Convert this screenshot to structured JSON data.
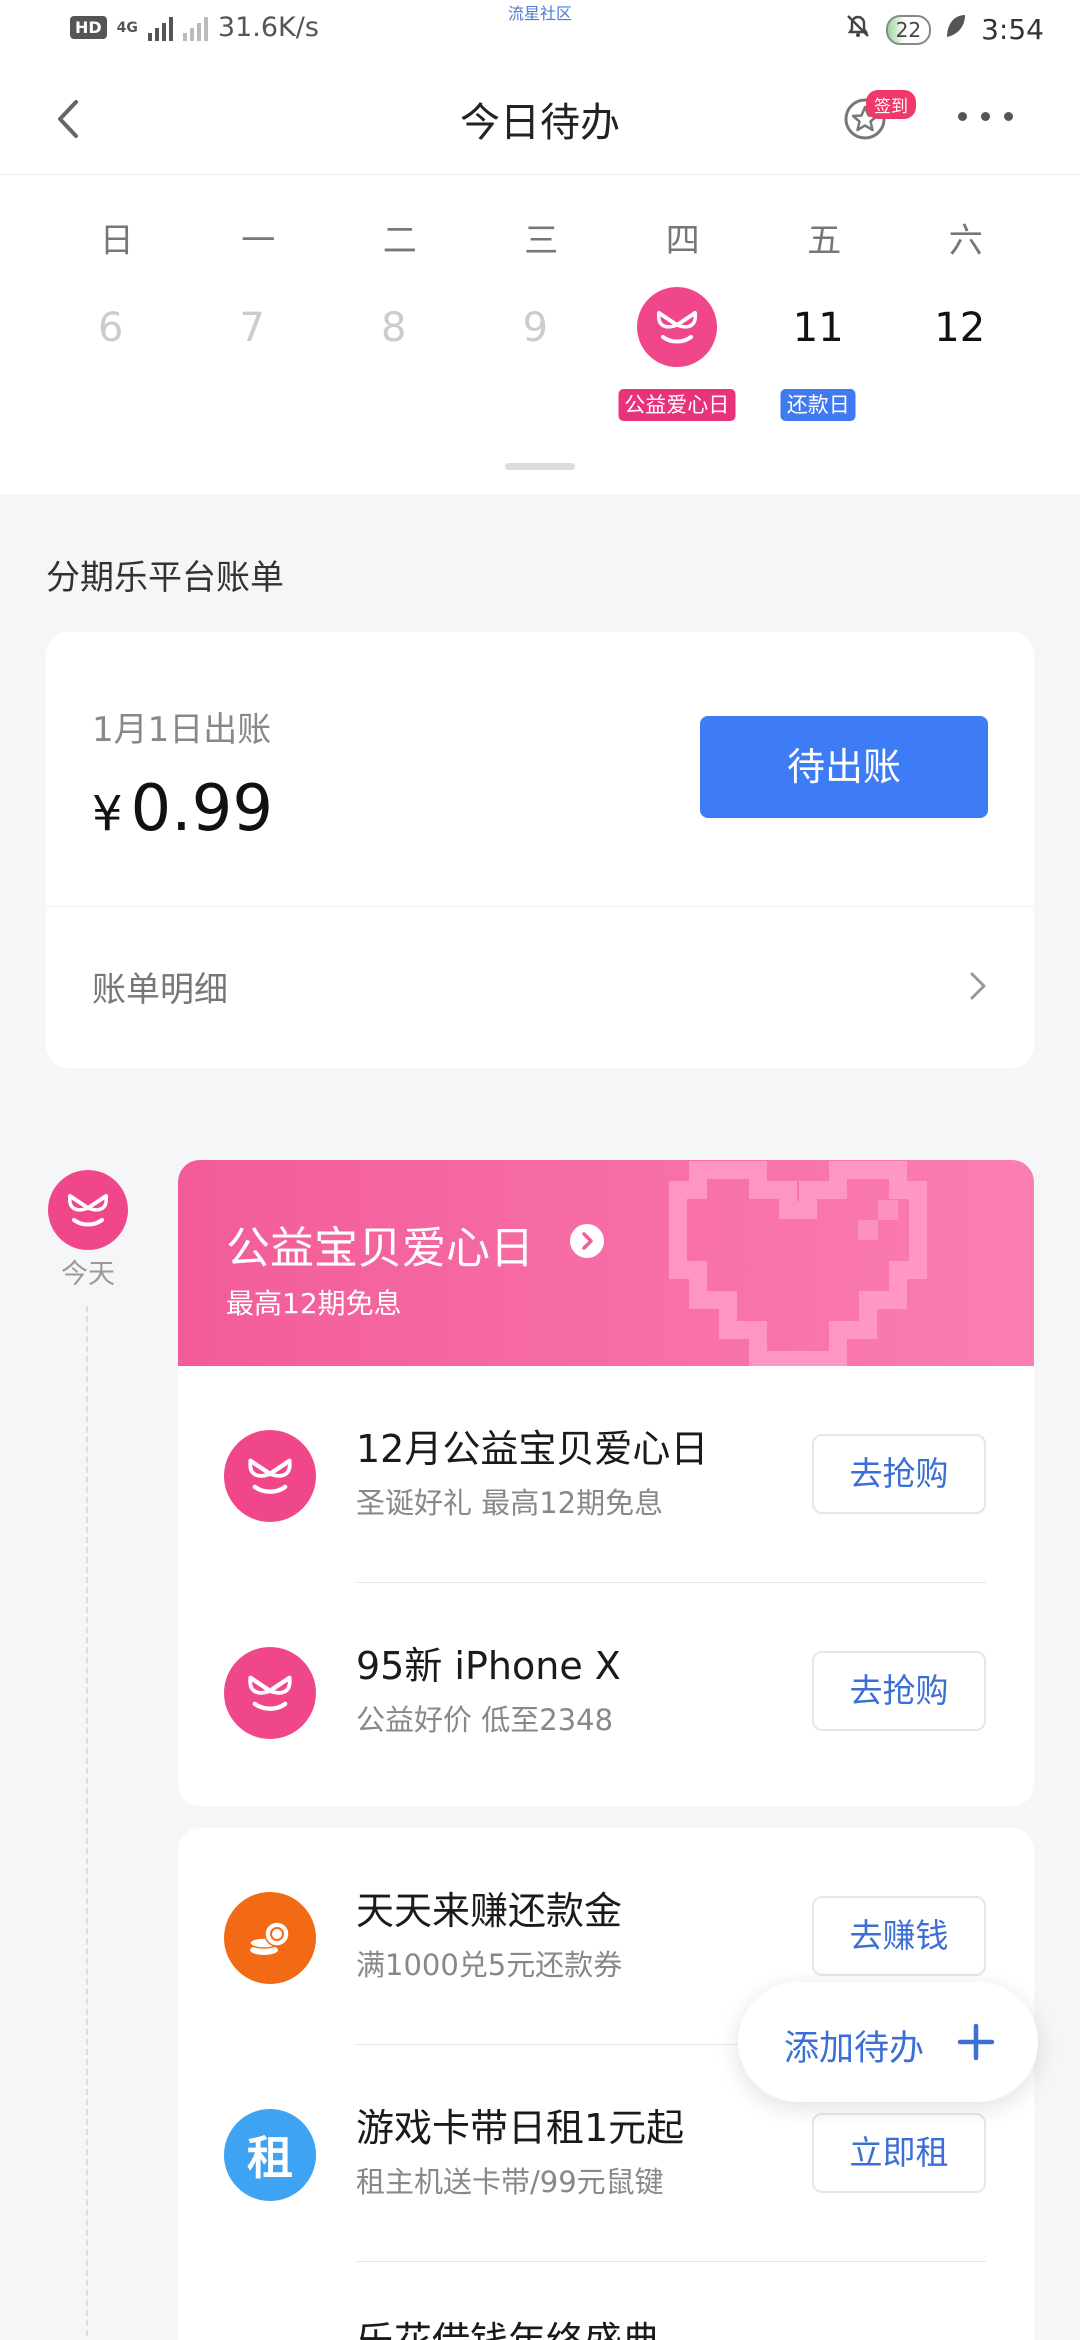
{
  "status_bar": {
    "hd": "HD",
    "sim": "1",
    "net": "4G",
    "speed": "31.6K/s",
    "carrier_center": "流星社区",
    "battery": "22",
    "time": "3:54"
  },
  "nav": {
    "title": "今日待办",
    "sign_badge": "签到"
  },
  "calendar": {
    "weekdays": [
      "日",
      "一",
      "二",
      "三",
      "四",
      "五",
      "六"
    ],
    "days": [
      "6",
      "7",
      "8",
      "9",
      "",
      "11",
      "12"
    ],
    "today_tag": "公益爱心日",
    "repay_tag": "还款日"
  },
  "section": {
    "title": "分期乐平台账单"
  },
  "bill": {
    "date": "1月1日出账",
    "currency": "¥",
    "amount": "0.99",
    "status_button": "待出账",
    "detail_link": "账单明细"
  },
  "timeline": {
    "label": "今天"
  },
  "promo": {
    "title": "公益宝贝爱心日",
    "subtitle": "最高12期免息",
    "items": [
      {
        "title": "12月公益宝贝爱心日",
        "sub": "圣诞好礼 最高12期免息",
        "button": "去抢购"
      },
      {
        "title": "95新 iPhone X",
        "sub": "公益好价 低至2348",
        "button": "去抢购"
      }
    ]
  },
  "tasks": {
    "items": [
      {
        "title": "天天来赚还款金",
        "sub": "满1000兑5元还款券",
        "button": "去赚钱",
        "icon_text": ""
      },
      {
        "title": "游戏卡带日租1元起",
        "sub": "租主机送卡带/99元鼠键",
        "button": "立即租",
        "icon_text": "租"
      }
    ],
    "partial_title": "乐花借钱年终盛典"
  },
  "fab": {
    "label": "添加待办"
  },
  "colors": {
    "accent_blue": "#3e7cf6",
    "brand_pink": "#f0478a",
    "coin_orange": "#f36a14",
    "rent_blue": "#3ea3f2"
  }
}
